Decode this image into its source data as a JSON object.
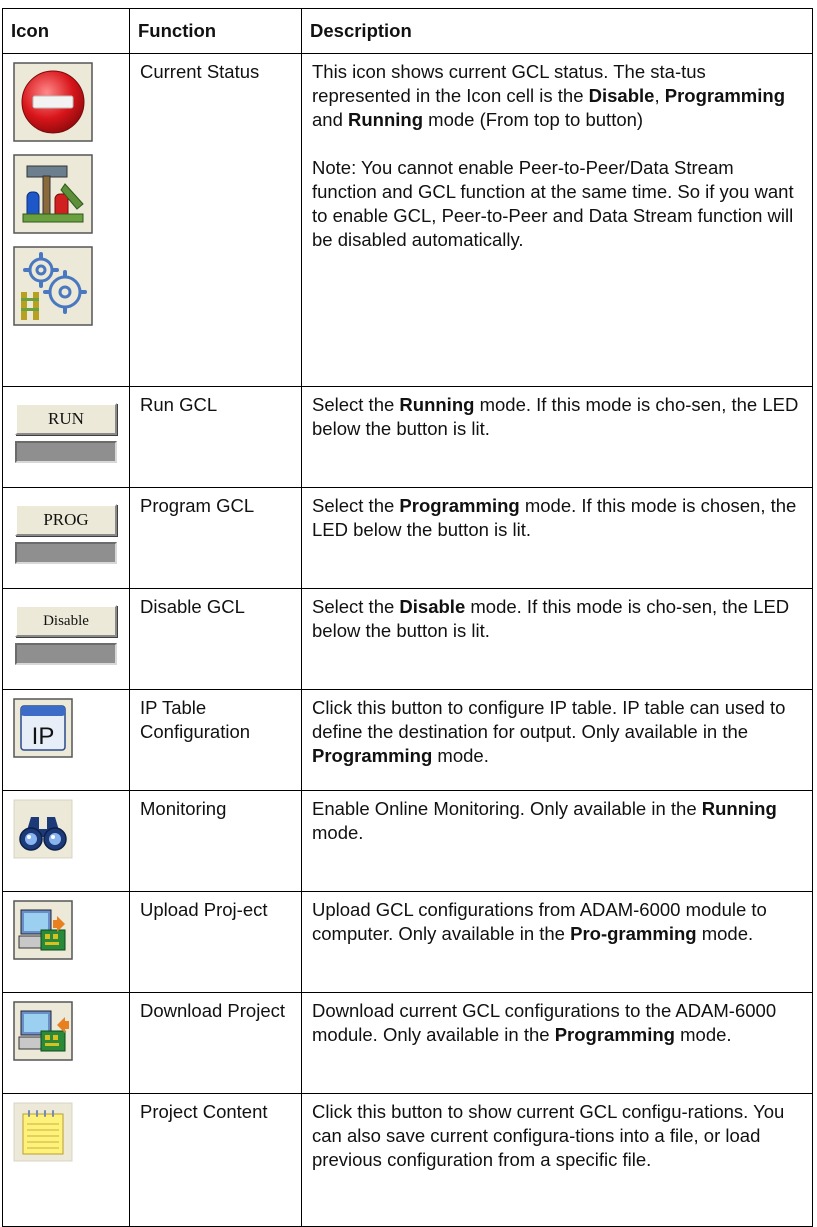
{
  "header": {
    "icon": "Icon",
    "function": "Function",
    "description": "Description"
  },
  "rows": [
    {
      "icon": [
        "disable-status-icon",
        "programming-status-icon",
        "running-status-icon"
      ],
      "function": "Current Status",
      "desc_parts": [
        "This icon shows current GCL status. The sta-tus represented in the Icon cell is the ",
        "Disable",
        ", ",
        "Programming",
        " and ",
        "Running",
        " mode (From top to button)"
      ],
      "note": "Note: You cannot enable Peer-to-Peer/Data Stream function and GCL function at the same time. So if you want to enable GCL, Peer-to-Peer and Data Stream function will be disabled automatically."
    },
    {
      "icon": "run-button-icon",
      "button_label": "RUN",
      "function": "Run GCL",
      "desc_parts": [
        "Select the ",
        "Running",
        " mode. If this mode is cho-sen, the LED below the button is lit."
      ]
    },
    {
      "icon": "prog-button-icon",
      "button_label": "PROG",
      "function": "Program GCL",
      "desc_parts": [
        "Select the ",
        "Programming",
        " mode. If this mode is chosen, the LED below the button is lit."
      ]
    },
    {
      "icon": "disable-button-icon",
      "button_label": "Disable",
      "function": "Disable GCL",
      "desc_parts": [
        "Select the ",
        "Disable",
        " mode. If this mode is cho-sen, the LED below the button is lit."
      ]
    },
    {
      "icon": "ip-table-icon",
      "icon_text": "IP",
      "function": "IP Table Configuration",
      "desc_parts": [
        "Click this button to configure IP table. IP table can used to define the destination for output. Only available in the ",
        "Programming",
        " mode."
      ]
    },
    {
      "icon": "binoculars-icon",
      "function": "Monitoring",
      "desc_parts": [
        "Enable Online Monitoring. Only available in the ",
        "Running",
        " mode."
      ]
    },
    {
      "icon": "upload-project-icon",
      "function": "Upload Proj-ect",
      "desc_parts": [
        "Upload GCL configurations from ADAM-6000 module to computer. Only available in the ",
        "Pro-gramming",
        " mode."
      ]
    },
    {
      "icon": "download-project-icon",
      "function": "Download Project",
      "desc_parts": [
        "Download current GCL configurations to the ADAM-6000 module. Only available in the ",
        "Programming",
        " mode."
      ]
    },
    {
      "icon": "notepad-icon",
      "function": "Project Content",
      "desc_parts": [
        "Click this button to show current GCL configu-rations. You can also save current configura-tions into a file, or load previous configuration from a specific file."
      ]
    }
  ]
}
